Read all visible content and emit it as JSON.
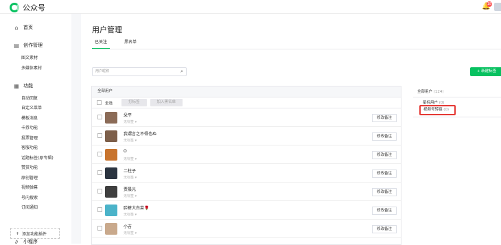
{
  "app": {
    "name": "公众号",
    "notification_count": "18"
  },
  "sidebar": {
    "home": "首页",
    "create": {
      "label": "创作管理",
      "items": [
        "图文素材",
        "多媒体素材"
      ]
    },
    "features": {
      "label": "功能",
      "items": [
        "自动回复",
        "自定义菜单",
        "模板消息",
        "卡券功能",
        "投票管理",
        "客服功能",
        "话题标签(原专辑)",
        "赞赏功能",
        "原创管理",
        "视频弹幕",
        "号内搜索",
        "订阅通知"
      ]
    },
    "add_plugin": "添加功能插件",
    "mini_program": "小程序"
  },
  "page": {
    "title": "用户管理",
    "tabs": [
      {
        "label": "已关注",
        "active": true
      },
      {
        "label": "黑名单",
        "active": false
      }
    ]
  },
  "search": {
    "placeholder": "用户昵称"
  },
  "new_tag_button": "+ 新建标签",
  "list": {
    "header": "全部用户",
    "select_all": "全选",
    "tag_button": "打标签",
    "blacklist_button": "加入黑名单",
    "edit_label": "修改备注",
    "users": [
      {
        "name": "朵平",
        "tag": "无标签",
        "avatar_color": "#8b6b57"
      },
      {
        "name": "我谓言之不得也ぬ",
        "tag": "无标签",
        "avatar_color": "#7d5f4a"
      },
      {
        "name": "O",
        "tag": "无标签",
        "avatar_color": "#c8742e"
      },
      {
        "name": "二柱子",
        "tag": "无标签",
        "avatar_color": "#2b3440"
      },
      {
        "name": "贾晨光",
        "tag": "无标签",
        "avatar_color": "#3f3f3f"
      },
      {
        "name": "脸裤大白菜🌹",
        "tag": "无标签",
        "avatar_color": "#4bb3c9"
      },
      {
        "name": "小吉",
        "tag": "无标签",
        "avatar_color": "#c9a98c"
      }
    ]
  },
  "groups": {
    "all_users": "全部用户",
    "all_users_count": "(124)",
    "star_users": "星标用户",
    "star_users_count": "(0)",
    "video_link": "视频号转链",
    "video_link_count": "(0)",
    "highlight_color": "#e53935"
  }
}
